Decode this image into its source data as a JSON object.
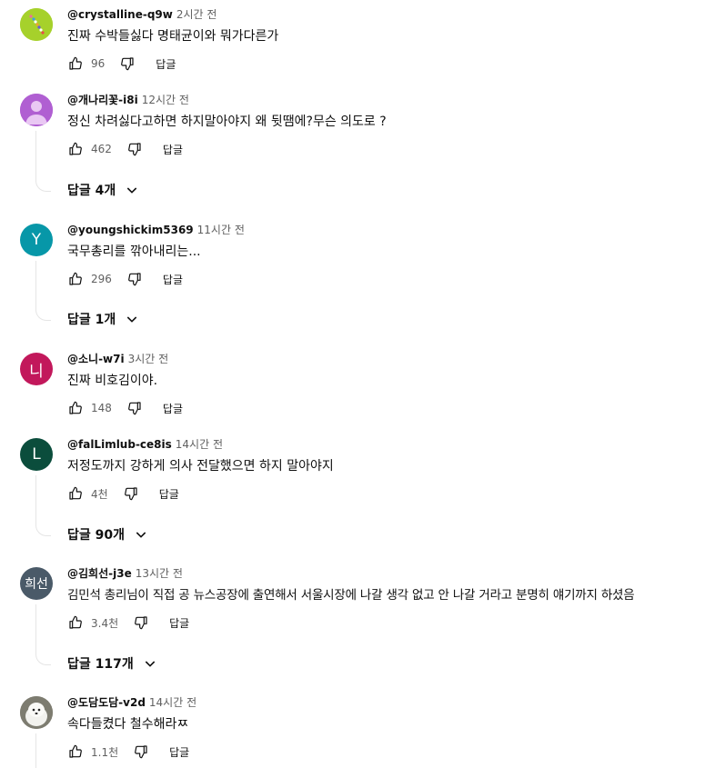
{
  "comments": [
    {
      "author": "@crystalline-q9w",
      "time": "2시간 전",
      "text": "진짜 수박들싫다 명태균이와 뭐가다른가",
      "likes": "96",
      "reply_label": "답글",
      "avatar": {
        "type": "pattern",
        "bg": "#a6d12b"
      }
    },
    {
      "author": "@개나리꽃-i8i",
      "time": "12시간 전",
      "text": "정신 차려싫다고하면 하지말아야지 왜 뒷땜에?무슨 의도로 ?",
      "likes": "462",
      "reply_label": "답글",
      "replies_label": "답글 4개",
      "avatar": {
        "type": "person",
        "bg": "#b05fd2"
      }
    },
    {
      "author": "@youngshickim5369",
      "time": "11시간 전",
      "text": "국무총리를 깎아내리는...",
      "likes": "296",
      "reply_label": "답글",
      "replies_label": "답글 1개",
      "avatar": {
        "type": "letter",
        "letter": "Y",
        "bg": "#0797a8"
      }
    },
    {
      "author": "@소니-w7i",
      "time": "3시간 전",
      "text": "진짜 비호김이야.",
      "likes": "148",
      "reply_label": "답글",
      "avatar": {
        "type": "letter",
        "letter": "니",
        "bg": "#c2185b"
      }
    },
    {
      "author": "@falLimlub-ce8is",
      "time": "14시간 전",
      "text": "저정도까지 강하게 의사 전달했으면 하지 말아야지",
      "likes": "4천",
      "reply_label": "답글",
      "replies_label": "답글 90개",
      "avatar": {
        "type": "letter",
        "letter": "L",
        "bg": "#0b4d3c"
      }
    },
    {
      "author": "@김희선-j3e",
      "time": "13시간 전",
      "text": "김민석 총리님이 직접 공 뉴스공장에 출연해서 서울시장에 나갈 생각 없고 안 나갈 거라고 분명히 얘기까지 하셨음",
      "likes": "3.4천",
      "reply_label": "답글",
      "replies_label": "답글 117개",
      "avatar": {
        "type": "letter",
        "letter": "희선",
        "bg": "#4a5a68"
      }
    },
    {
      "author": "@도담도담-v2d",
      "time": "14시간 전",
      "text": "속다들켰다 철수해라ㅉ",
      "likes": "1.1천",
      "reply_label": "답글",
      "avatar": {
        "type": "photo",
        "bg": "#8a8a80"
      }
    }
  ]
}
